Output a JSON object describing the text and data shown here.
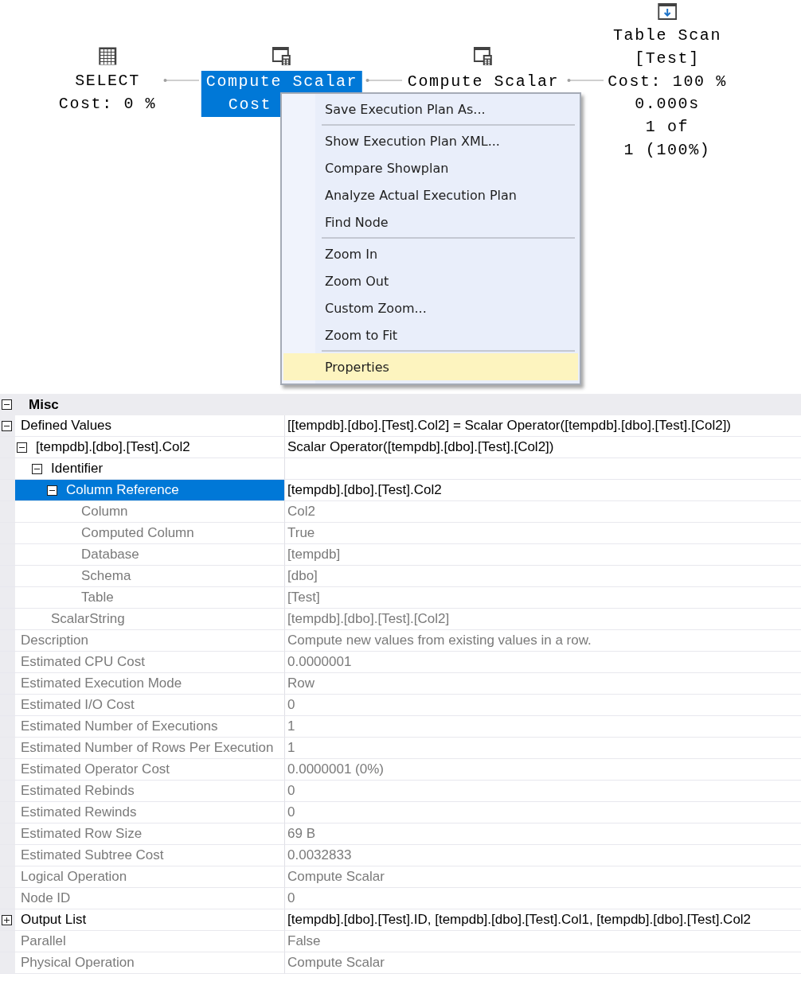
{
  "plan": {
    "nodes": [
      {
        "kind": "select",
        "selected": false,
        "lines": [
          "SELECT",
          "Cost: 0 %"
        ]
      },
      {
        "kind": "compute",
        "selected": true,
        "lines": [
          "Compute Scalar",
          "Cost"
        ]
      },
      {
        "kind": "compute",
        "selected": false,
        "lines": [
          "Compute Scalar"
        ]
      },
      {
        "kind": "scan",
        "selected": false,
        "lines": [
          "Table Scan",
          "[Test]",
          "Cost: 100 %",
          "0.000s",
          "1 of",
          "1 (100%)"
        ]
      }
    ]
  },
  "context_menu": {
    "groups": [
      [
        {
          "label": "Save Execution Plan As...",
          "highlighted": false
        }
      ],
      [
        {
          "label": "Show Execution Plan XML...",
          "highlighted": false
        },
        {
          "label": "Compare Showplan",
          "highlighted": false
        },
        {
          "label": "Analyze Actual Execution Plan",
          "highlighted": false
        },
        {
          "label": "Find Node",
          "highlighted": false
        }
      ],
      [
        {
          "label": "Zoom In",
          "highlighted": false
        },
        {
          "label": "Zoom Out",
          "highlighted": false
        },
        {
          "label": "Custom Zoom...",
          "highlighted": false
        },
        {
          "label": "Zoom to Fit",
          "highlighted": false
        }
      ],
      [
        {
          "label": "Properties",
          "highlighted": true
        }
      ]
    ]
  },
  "properties": {
    "category": {
      "name": "Misc",
      "expanded": true
    },
    "rows": [
      {
        "name": "Defined Values",
        "value": "[[tempdb].[dbo].[Test].Col2] = Scalar Operator([tempdb].[dbo].[Test].[Col2])",
        "expanded": true,
        "selected": false,
        "read_only": false,
        "children": [
          {
            "name": "[tempdb].[dbo].[Test].Col2",
            "value": "Scalar Operator([tempdb].[dbo].[Test].[Col2])",
            "expanded": true,
            "selected": false,
            "read_only": false,
            "children": [
              {
                "name": "Identifier",
                "expanded": true,
                "selected": false,
                "read_only": false,
                "children": [
                  {
                    "name": "Column Reference",
                    "value": "[tempdb].[dbo].[Test].Col2",
                    "expanded": true,
                    "selected": true,
                    "read_only": false,
                    "children": [
                      {
                        "name": "Column",
                        "value": "Col2",
                        "selected": false,
                        "read_only": true
                      },
                      {
                        "name": "Computed Column",
                        "value": "True",
                        "selected": false,
                        "read_only": true
                      },
                      {
                        "name": "Database",
                        "value": "[tempdb]",
                        "selected": false,
                        "read_only": true
                      },
                      {
                        "name": "Schema",
                        "value": "[dbo]",
                        "selected": false,
                        "read_only": true
                      },
                      {
                        "name": "Table",
                        "value": "[Test]",
                        "selected": false,
                        "read_only": true
                      }
                    ]
                  }
                ]
              },
              {
                "name": "ScalarString",
                "value": "[tempdb].[dbo].[Test].[Col2]",
                "selected": false,
                "read_only": true
              }
            ]
          }
        ]
      },
      {
        "name": "Description",
        "value": "Compute new values from existing values in a row.",
        "selected": false,
        "read_only": true
      },
      {
        "name": "Estimated CPU Cost",
        "value": "0.0000001",
        "selected": false,
        "read_only": true
      },
      {
        "name": "Estimated Execution Mode",
        "value": "Row",
        "selected": false,
        "read_only": true
      },
      {
        "name": "Estimated I/O Cost",
        "value": "0",
        "selected": false,
        "read_only": true
      },
      {
        "name": "Estimated Number of Executions",
        "value": "1",
        "selected": false,
        "read_only": true
      },
      {
        "name": "Estimated Number of Rows Per Execution",
        "value": "1",
        "selected": false,
        "read_only": true
      },
      {
        "name": "Estimated Operator Cost",
        "value": "0.0000001 (0%)",
        "selected": false,
        "read_only": true
      },
      {
        "name": "Estimated Rebinds",
        "value": "0",
        "selected": false,
        "read_only": true
      },
      {
        "name": "Estimated Rewinds",
        "value": "0",
        "selected": false,
        "read_only": true
      },
      {
        "name": "Estimated Row Size",
        "value": "69 B",
        "selected": false,
        "read_only": true
      },
      {
        "name": "Estimated Subtree Cost",
        "value": "0.0032833",
        "selected": false,
        "read_only": true
      },
      {
        "name": "Logical Operation",
        "value": "Compute Scalar",
        "selected": false,
        "read_only": true
      },
      {
        "name": "Node ID",
        "value": "0",
        "selected": false,
        "read_only": true
      },
      {
        "name": "Output List",
        "value": "[tempdb].[dbo].[Test].ID, [tempdb].[dbo].[Test].Col1, [tempdb].[dbo].[Test].Col2",
        "expanded": false,
        "selected": false,
        "read_only": false
      },
      {
        "name": "Parallel",
        "value": "False",
        "selected": false,
        "read_only": true
      },
      {
        "name": "Physical Operation",
        "value": "Compute Scalar",
        "selected": false,
        "read_only": true
      }
    ]
  }
}
